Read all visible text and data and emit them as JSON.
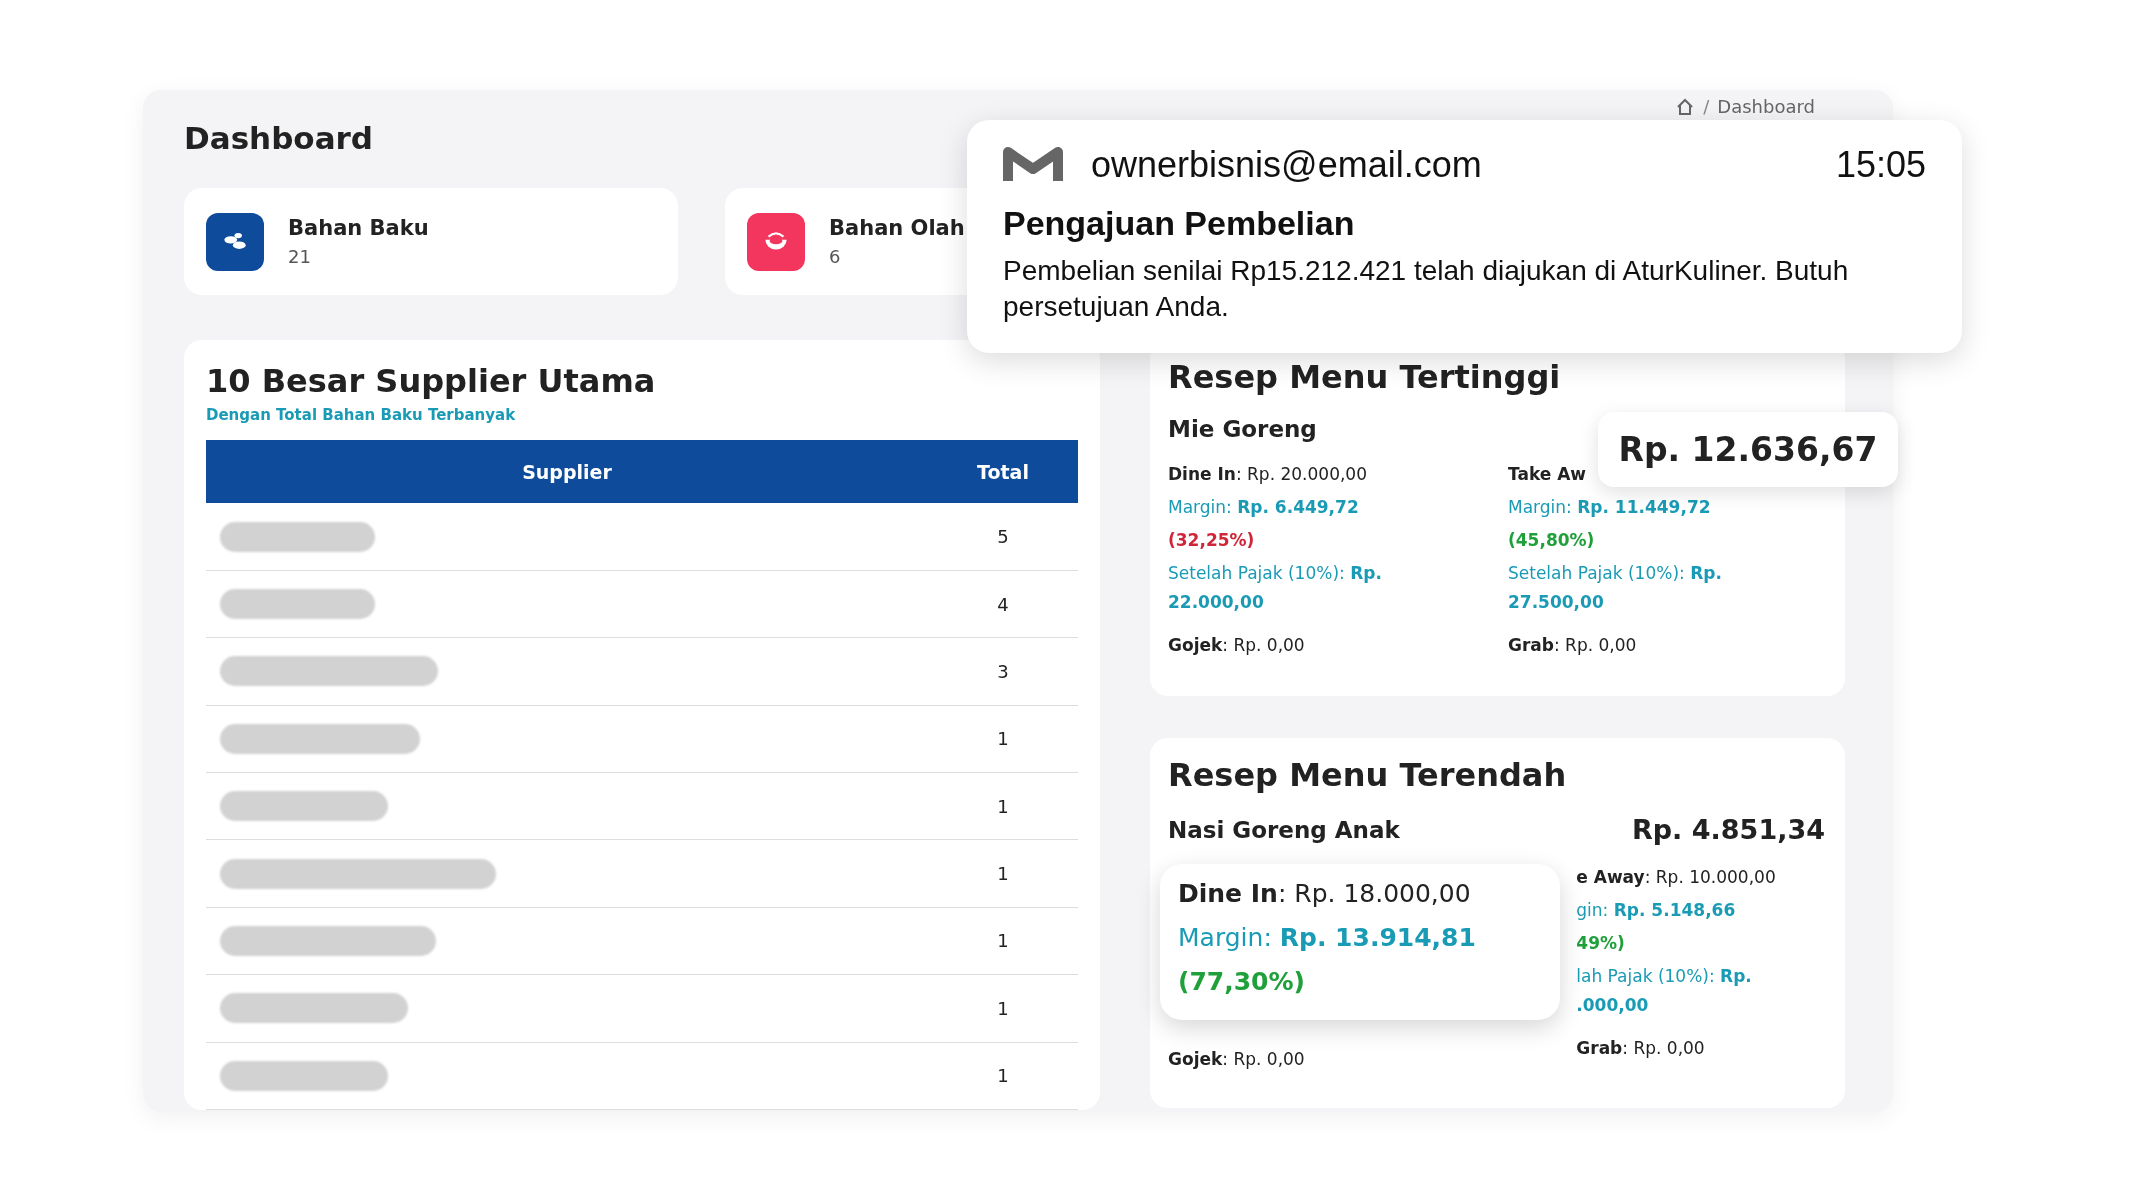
{
  "page_title": "Dashboard",
  "breadcrumb": {
    "separator": "/",
    "items": [
      "Dashboard"
    ]
  },
  "stat_cards": [
    {
      "kind": "beans",
      "label": "Bahan Baku",
      "value": "21"
    },
    {
      "kind": "bowl",
      "label": "Bahan Olah",
      "value": "6"
    }
  ],
  "top_suppliers": {
    "title": "10 Besar Supplier Utama",
    "subtitle": "Dengan Total Bahan Baku Terbanyak",
    "columns": [
      "Supplier",
      "Total"
    ],
    "rows": [
      {
        "total": "5"
      },
      {
        "total": "4"
      },
      {
        "total": "3"
      },
      {
        "total": "1"
      },
      {
        "total": "1"
      },
      {
        "total": "1"
      },
      {
        "total": "1"
      },
      {
        "total": "1"
      },
      {
        "total": "1"
      }
    ]
  },
  "highest_recipe": {
    "title": "Resep Menu Tertinggi",
    "menu": "Mie Goreng",
    "price_popup": "Rp. 12.636,67",
    "left_lines": [
      {
        "kind": "plain",
        "text": "**Dine In**: Rp. 20.000,00"
      },
      {
        "kind": "accent",
        "text": "Margin: **Rp. 6.449,72**"
      },
      {
        "kind": "percent",
        "positive": false,
        "text": "(32,25%)"
      },
      {
        "kind": "accent",
        "text": "Setelah Pajak (10%): **Rp. 22.000,00**"
      },
      {
        "kind": "plain",
        "text": "**Gojek**: Rp. 0,00"
      }
    ],
    "right_lines": [
      {
        "kind": "plain",
        "text": "**Take Aw**"
      },
      {
        "kind": "accent",
        "text": "Margin: **Rp. 11.449,72**"
      },
      {
        "kind": "percent",
        "positive": true,
        "text": "(45,80%)"
      },
      {
        "kind": "accent",
        "text": "Setelah Pajak (10%): **Rp. 27.500,00**"
      },
      {
        "kind": "plain",
        "text": "**Grab**: Rp. 0,00"
      }
    ]
  },
  "lowest_recipe": {
    "title": "Resep Menu Terendah",
    "menu": "Nasi Goreng Anak",
    "price": "Rp. 4.851,34",
    "detail_popup": [
      {
        "kind": "plain",
        "text": "**Dine In**: Rp. 18.000,00"
      },
      {
        "kind": "accent",
        "text": "Margin: **Rp. 13.914,81**"
      },
      {
        "kind": "percent",
        "positive": true,
        "text": "(77,30%)"
      }
    ],
    "left_lines": [
      {
        "kind": "plain",
        "text": "**Gojek**: Rp. 0,00"
      }
    ],
    "right_lines": [
      {
        "kind": "plain",
        "text": "**e Away**: Rp. 10.000,00"
      },
      {
        "kind": "accent",
        "text": "gin: **Rp. 5.148,66**"
      },
      {
        "kind": "percent",
        "positive": true,
        "text": "49%)"
      },
      {
        "kind": "accent",
        "text": "lah Pajak (10%): **Rp. .000,00**"
      },
      {
        "kind": "plain",
        "text": "**Grab**: Rp. 0,00"
      }
    ]
  },
  "notification": {
    "sender": "ownerbisnis@email.com",
    "time": "15:05",
    "title": "Pengajuan Pembelian",
    "body": "Pembelian senilai Rp15.212.421 telah diajukan di AturKuliner. Butuh persetujuan Anda."
  }
}
